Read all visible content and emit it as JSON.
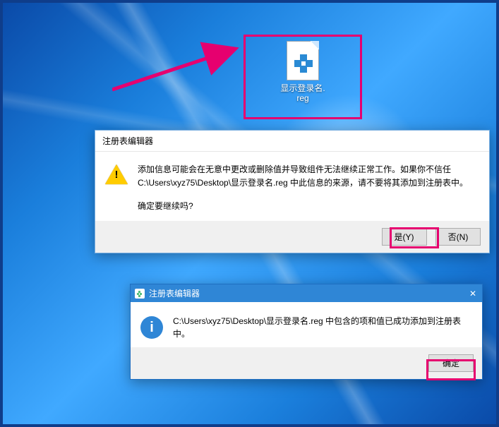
{
  "desktop": {
    "file": {
      "name_line1": "显示登录名.",
      "name_line2": "reg"
    }
  },
  "dialog1": {
    "title": "注册表编辑器",
    "message_line1": "添加信息可能会在无意中更改或删除值并导致组件无法继续正常工作。如果你不信任 C:\\Users\\xyz75\\Desktop\\显示登录名.reg 中此信息的来源，请不要将其添加到注册表中。",
    "message_line2": "确定要继续吗?",
    "buttons": {
      "yes": "是(Y)",
      "no": "否(N)"
    }
  },
  "dialog2": {
    "title": "注册表编辑器",
    "message": "C:\\Users\\xyz75\\Desktop\\显示登录名.reg 中包含的项和值已成功添加到注册表中。",
    "buttons": {
      "ok": "确定"
    }
  },
  "icons": {
    "warning": "warning-triangle",
    "info": "info-circle",
    "close": "✕"
  }
}
